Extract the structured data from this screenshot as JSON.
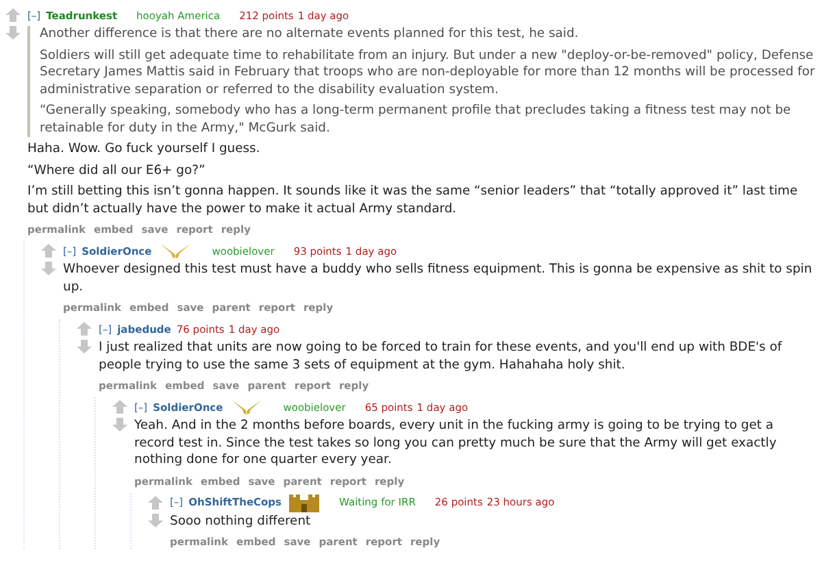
{
  "comments": [
    {
      "collapse": "[–]",
      "author": "Teadrunkest",
      "submitter": true,
      "flair": "hooyah America",
      "score": "212 points",
      "time": "1 day ago",
      "body": [
        {
          "kind": "quote",
          "paragraphs": [
            "Another difference is that there are no alternate events planned for this test, he said.",
            "Soldiers will still get adequate time to rehabilitate from an injury. But under a new \"deploy-or-be-removed\" policy, Defense Secretary James Mattis said in February that troops who are non-deployable for more than 12 months will be processed for administrative separation or referred to the disability evaluation system.",
            "“Generally speaking, somebody who has a long-term permanent profile that precludes taking a fitness test may not be retainable for duty in the Army,\" McGurk said."
          ]
        },
        {
          "kind": "text",
          "text": "Haha. Wow. Go fuck yourself I guess."
        },
        {
          "kind": "text",
          "text": "“Where did all our E6+ go?”"
        },
        {
          "kind": "text",
          "text": "I’m still betting this isn’t gonna happen. It sounds like it was the same “senior leaders” that “totally approved it” last time but didn’t actually have the power to make it actual Army standard."
        }
      ],
      "actions": [
        "permalink",
        "embed",
        "save",
        "report",
        "reply"
      ],
      "children": [
        {
          "collapse": "[–]",
          "author": "SoldierOnce",
          "submitter": false,
          "badge": {
            "kind": "pistols"
          },
          "flair": "woobielover",
          "score": "93 points",
          "time": "1 day ago",
          "body": [
            {
              "kind": "text",
              "text": "Whoever designed this test must have a buddy who sells fitness equipment. This is gonna be expensive as shit to spin up."
            }
          ],
          "actions": [
            "permalink",
            "embed",
            "save",
            "parent",
            "report",
            "reply"
          ],
          "children": [
            {
              "collapse": "[–]",
              "author": "jabedude",
              "submitter": false,
              "score": "76 points",
              "time": "1 day ago",
              "body": [
                {
                  "kind": "text",
                  "text": "I just realized that units are now going to be forced to train for these events, and you'll end up with BDE's of people trying to use the same 3 sets of equipment at the gym. Hahahaha holy shit."
                }
              ],
              "actions": [
                "permalink",
                "embed",
                "save",
                "parent",
                "report",
                "reply"
              ],
              "children": [
                {
                  "collapse": "[–]",
                  "author": "SoldierOnce",
                  "submitter": false,
                  "badge": {
                    "kind": "pistols"
                  },
                  "flair": "woobielover",
                  "score": "65 points",
                  "time": "1 day ago",
                  "body": [
                    {
                      "kind": "text",
                      "text": "Yeah. And in the 2 months before boards, every unit in the fucking army is going to be trying to get a record test in. Since the test takes so long you can pretty much be sure that the Army will get exactly nothing done for one quarter every year."
                    }
                  ],
                  "actions": [
                    "permalink",
                    "embed",
                    "save",
                    "parent",
                    "report",
                    "reply"
                  ],
                  "children": [
                    {
                      "collapse": "[–]",
                      "author": "OhShiftTheCops",
                      "submitter": false,
                      "badge": {
                        "kind": "castle"
                      },
                      "flair": "Waiting for IRR",
                      "score": "26 points",
                      "time": "23 hours ago",
                      "body": [
                        {
                          "kind": "text",
                          "text": "Sooo nothing different"
                        }
                      ],
                      "actions": [
                        "permalink",
                        "embed",
                        "save",
                        "parent",
                        "report",
                        "reply"
                      ]
                    }
                  ]
                }
              ]
            }
          ]
        }
      ]
    }
  ]
}
